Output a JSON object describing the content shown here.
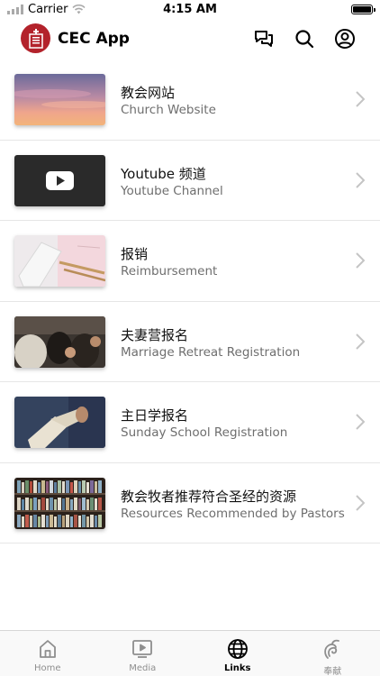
{
  "status_bar": {
    "carrier": "Carrier",
    "time": "4:15 AM"
  },
  "header": {
    "title": "CEC App"
  },
  "links": [
    {
      "title": "教会网站",
      "subtitle": "Church Website",
      "thumbnail": "sunset-sky"
    },
    {
      "title": "Youtube 频道",
      "subtitle": "Youtube Channel",
      "thumbnail": "youtube-play"
    },
    {
      "title": "报销",
      "subtitle": "Reimbursement",
      "thumbnail": "notebook-pens"
    },
    {
      "title": "夫妻营报名",
      "subtitle": "Marriage Retreat Registration",
      "thumbnail": "praying-people"
    },
    {
      "title": "主日学报名",
      "subtitle": "Sunday School Registration",
      "thumbnail": "open-bible"
    },
    {
      "title": "教会牧者推荐符合圣经的资源",
      "subtitle": "Resources Recommended by Pastors",
      "thumbnail": "bookshelf"
    }
  ],
  "tabs": [
    {
      "label": "Home",
      "icon": "home-icon"
    },
    {
      "label": "Media",
      "icon": "media-icon"
    },
    {
      "label": "Links",
      "icon": "globe-icon",
      "active": true
    },
    {
      "label": "奉献",
      "icon": "offering-icon"
    }
  ],
  "colors": {
    "brand": "#b3222b",
    "active_tab": "#000000",
    "inactive_tab": "#8e8e8e"
  }
}
